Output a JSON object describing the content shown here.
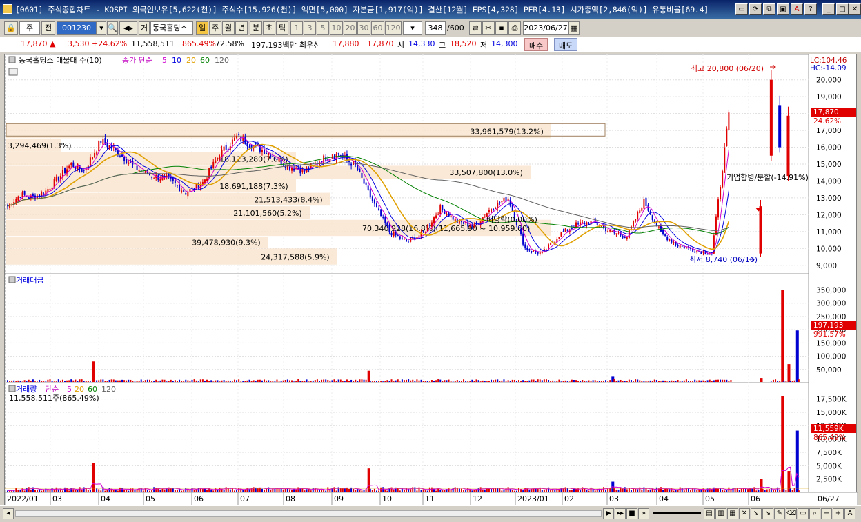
{
  "window": {
    "title": "[0601] 주식종합차트 - KOSPI 외국인보유[5,622(천)] 주식수[15,926(천)] 액면[5,000] 자본금[1,917(억)] 결산[12월] EPS[4,328] PER[4.13] 시가총액[2,846(억)] 유통비율[69.4]",
    "controls": [
      "▭",
      "⟳",
      "⧉",
      "▣",
      "A",
      "?",
      "_",
      "□",
      "✕"
    ]
  },
  "toolbar": {
    "market": "주",
    "prev": "전",
    "code": "001230",
    "stock_name": "동국홀딩스",
    "period_buttons": [
      "일",
      "주",
      "월",
      "년",
      "분",
      "초",
      "틱"
    ],
    "period_selected": "일",
    "interval_buttons": [
      "1",
      "3",
      "5",
      "10",
      "20",
      "30",
      "60",
      "120"
    ],
    "count": "348",
    "count_total": "/600",
    "date": "2023/06/27",
    "ge_label": "거"
  },
  "quote": {
    "price": "17,870",
    "change_arrow": "▲",
    "change": "3,530",
    "change_pct": "+24.62%",
    "volume": "11,558,511",
    "volume_pct": "865.49%",
    "turnover": "72.58%",
    "amount": "197,193백만",
    "best_label": "최우선",
    "best_ask": "17,880",
    "best_bid": "17,870",
    "open_label": "시",
    "open": "14,330",
    "high_label": "고",
    "high": "18,520",
    "low_label": "저",
    "low": "14,300",
    "buy_label": "매수",
    "sell_label": "매도"
  },
  "chart_data": [
    {
      "type": "candlestick",
      "title": "동국홀딩스 매물대 수(10)",
      "ma_label": "종가 단순",
      "ma_periods": [
        "5",
        "10",
        "20",
        "60",
        "120"
      ],
      "ma_colors": [
        "#d000d0",
        "#0000e0",
        "#e0a000",
        "#008000",
        "#606060"
      ],
      "lc_label": "LC:104.46",
      "hc_label": "HC:-14.09",
      "ylim": [
        8500,
        21500
      ],
      "y_ticks": [
        9000,
        10000,
        11000,
        12000,
        13000,
        14000,
        15000,
        16000,
        17000,
        18000,
        19000,
        20000
      ],
      "y_tick_labels": [
        "9,000",
        "10,000",
        "11,000",
        "12,000",
        "13,000",
        "14,000",
        "15,000",
        "16,000",
        "17,000",
        "18,000",
        "19,000",
        "20,000"
      ],
      "current_price_label": "17,870",
      "current_change_label": "24.62%",
      "current_price": 17870,
      "high_annotation": "최고 20,800 (06/20)",
      "high_value": 20800,
      "low_annotation": "최저 8,740 (06/16)",
      "low_value": 8740,
      "event_annotations": [
        "기업합병/분할(-14.91%)",
        "배당락(0.00%)"
      ],
      "volume_profile": [
        {
          "label": "24,317,588(5.9%)",
          "low": 9000,
          "high": 10000
        },
        {
          "label": "39,478,930(9.3%)",
          "low": 10000,
          "high": 10700
        },
        {
          "label": "70,340,928(16.8%)(11,665.90 ~ 10,959.60)",
          "low": 10700,
          "high": 11700
        },
        {
          "label": "21,101,560(5.2%)",
          "low": 11700,
          "high": 12500
        },
        {
          "label": "21,513,433(8.4%)",
          "low": 12500,
          "high": 13300
        },
        {
          "label": "18,691,188(7.3%)",
          "low": 13300,
          "high": 14100
        },
        {
          "label": "33,507,800(13.0%)",
          "low": 14100,
          "high": 14900
        },
        {
          "label": "18,123,280(7.0%)",
          "low": 14900,
          "high": 15700
        },
        {
          "label": "3,294,469(1.3%)",
          "low": 15700,
          "high": 16500
        },
        {
          "label": "33,961,579(13.2%)",
          "low": 16500,
          "high": 17400
        }
      ],
      "close_path_x": [
        0,
        6,
        12,
        18,
        24,
        30,
        36,
        44,
        52,
        60,
        68,
        76,
        84,
        92,
        100,
        108,
        116,
        124,
        132,
        140,
        148,
        156,
        164,
        172,
        180,
        188,
        196,
        204,
        212,
        220,
        228,
        236,
        244,
        252,
        260,
        268,
        276,
        284,
        292,
        300,
        308,
        316,
        324,
        332,
        340
      ],
      "close_path_y": [
        12500,
        13200,
        13000,
        13400,
        14200,
        15000,
        14600,
        16400,
        15700,
        14800,
        14300,
        14100,
        13300,
        13900,
        15600,
        16600,
        16100,
        15600,
        14900,
        14600,
        15300,
        15600,
        14900,
        12800,
        11000,
        10400,
        10900,
        12400,
        11600,
        11300,
        12400,
        13000,
        10000,
        9700,
        10800,
        11400,
        11600,
        11000,
        10700,
        12800,
        10900,
        10200,
        9900,
        9700,
        17870
      ],
      "x_months": [
        "2022/01",
        "03",
        "04",
        "05",
        "06",
        "07",
        "08",
        "09",
        "10",
        "11",
        "12",
        "2023/01",
        "02",
        "03",
        "04",
        "05",
        "06"
      ],
      "x_end_label": "06/27"
    },
    {
      "type": "bar",
      "title": "거래대금",
      "ylim": [
        0,
        380000
      ],
      "y_ticks": [
        50000,
        100000,
        150000,
        200000,
        250000,
        300000,
        350000
      ],
      "y_tick_labels": [
        "50,000",
        "100,000",
        "150,000",
        "200,000",
        "250,000",
        "300,000",
        "350,000"
      ],
      "current_label": "197,193",
      "current_pct": "991.57%",
      "current_value": 197193,
      "spikes": [
        [
          40,
          80000
        ],
        [
          170,
          45000
        ],
        [
          285,
          25000
        ],
        [
          355,
          18000
        ],
        [
          365,
          350000
        ],
        [
          368,
          70000
        ],
        [
          372,
          197193
        ]
      ]
    },
    {
      "type": "bar",
      "title": "거래량",
      "ma_label": "단순",
      "ma_periods": [
        "5",
        "20",
        "60",
        "120"
      ],
      "current_text": "11,558,511주(865.49%)",
      "ylim": [
        0,
        19000
      ],
      "y_ticks": [
        2500,
        5000,
        7500,
        10000,
        12500,
        15000,
        17500
      ],
      "y_tick_labels": [
        "2,500K",
        "5,000K",
        "7,500K",
        "10,000K",
        "12,500K",
        "15,000K",
        "17,500K"
      ],
      "current_label": "11,559K",
      "current_pct": "865.49%",
      "current_value": 11559,
      "spikes": [
        [
          40,
          5500
        ],
        [
          170,
          4500
        ],
        [
          285,
          2000
        ],
        [
          355,
          2500
        ],
        [
          365,
          18000
        ],
        [
          368,
          4000
        ],
        [
          372,
          11559
        ]
      ]
    }
  ],
  "statusbar": {
    "icons": [
      "play-icon",
      "step-icon",
      "stop-icon",
      "fast-icon"
    ]
  }
}
